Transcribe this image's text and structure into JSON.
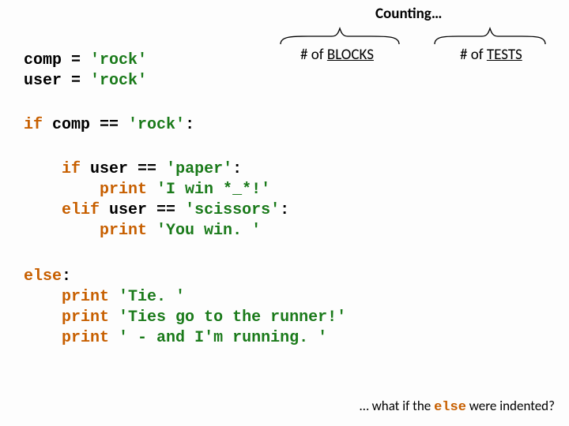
{
  "header": {
    "counting": "Counting…",
    "blocks_prefix": "# of ",
    "blocks_word": "BLOCKS",
    "tests_prefix": "# of ",
    "tests_word": "TESTS"
  },
  "code": {
    "l1_a": "comp = ",
    "l1_b": "'rock'",
    "l2_a": "user = ",
    "l2_b": "'rock'",
    "l3_a": "if",
    "l3_b": " comp == ",
    "l3_c": "'rock'",
    "l3_d": ":",
    "l4_a": "    ",
    "l4_b": "if",
    "l4_c": " user == ",
    "l4_d": "'paper'",
    "l4_e": ":",
    "l5_a": "        ",
    "l5_b": "print",
    "l5_c": " ",
    "l5_d": "'I win *_*!'",
    "l6_a": "    ",
    "l6_b": "elif",
    "l6_c": " user == ",
    "l6_d": "'scissors'",
    "l6_e": ":",
    "l7_a": "        ",
    "l7_b": "print",
    "l7_c": " ",
    "l7_d": "'You win. '",
    "l8_a": "else",
    "l8_b": ":",
    "l9_a": "    ",
    "l9_b": "print",
    "l9_c": " ",
    "l9_d": "'Tie. '",
    "l10_a": "    ",
    "l10_b": "print",
    "l10_c": " ",
    "l10_d": "'Ties go to the runner!'",
    "l11_a": "    ",
    "l11_b": "print",
    "l11_c": " ",
    "l11_d": "' - and I'm running. '"
  },
  "footnote": {
    "prefix": "… what if the ",
    "kw": "else",
    "suffix": " were indented?"
  }
}
